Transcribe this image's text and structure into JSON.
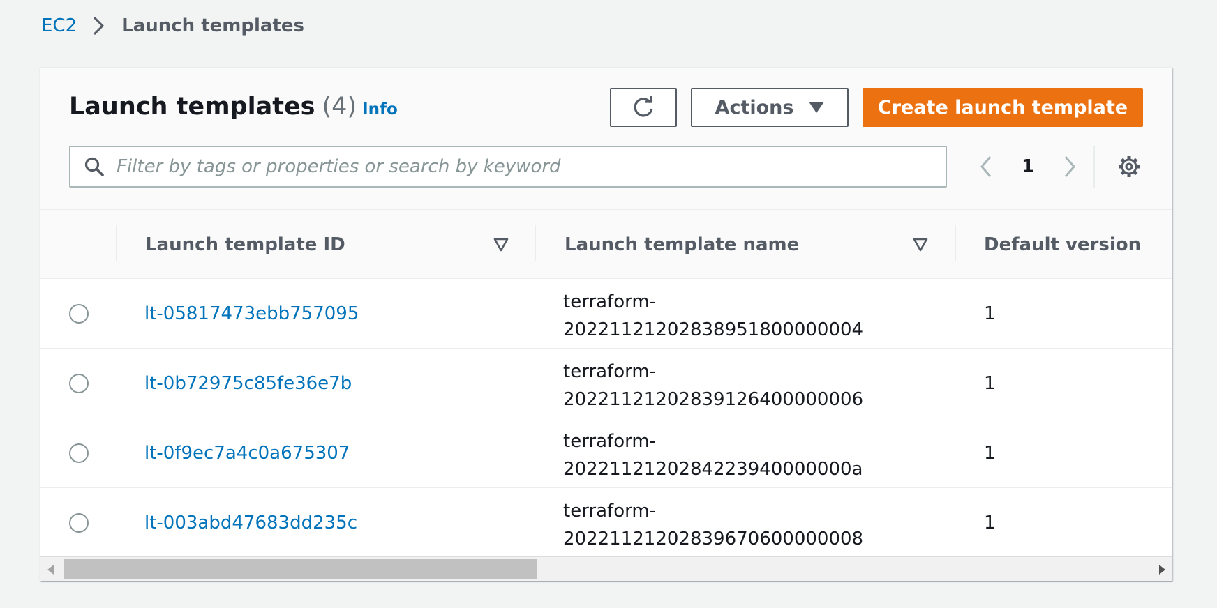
{
  "breadcrumb": {
    "root": "EC2",
    "current": "Launch templates"
  },
  "header": {
    "title": "Launch templates",
    "count": "(4)",
    "info": "Info"
  },
  "toolbar": {
    "refresh_icon": "refresh-icon",
    "actions_label": "Actions",
    "create_label": "Create launch template"
  },
  "search": {
    "placeholder": "Filter by tags or properties or search by keyword",
    "value": ""
  },
  "pagination": {
    "current_page": "1"
  },
  "table": {
    "columns": [
      "Launch template ID",
      "Launch template name",
      "Default version"
    ],
    "rows": [
      {
        "id": "lt-05817473ebb757095",
        "name_line1": "terraform-",
        "name_line2": "20221121202838951800000004",
        "version": "1"
      },
      {
        "id": "lt-0b72975c85fe36e7b",
        "name_line1": "terraform-",
        "name_line2": "20221121202839126400000006",
        "version": "1"
      },
      {
        "id": "lt-0f9ec7a4c0a675307",
        "name_line1": "terraform-",
        "name_line2": "2022112120284223940000000a",
        "version": "1"
      },
      {
        "id": "lt-003abd47683dd235c",
        "name_line1": "terraform-",
        "name_line2": "20221121202839670600000008",
        "version": "1"
      }
    ]
  },
  "colors": {
    "link": "#0073bb",
    "primary_button": "#ec7211",
    "background": "#f2f3f3",
    "text": "#16191f"
  }
}
